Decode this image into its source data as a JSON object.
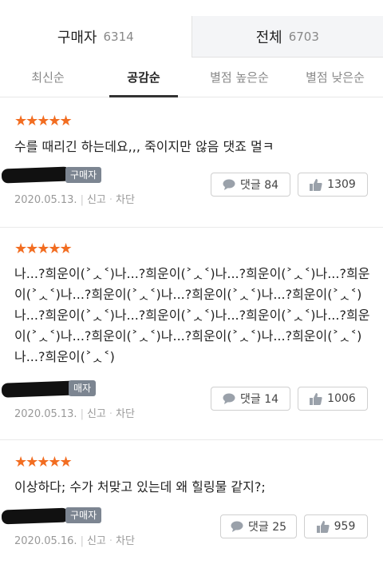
{
  "tabs": [
    {
      "label": "구매자",
      "count": "6314"
    },
    {
      "label": "전체",
      "count": "6703"
    }
  ],
  "sort_options": [
    "최신순",
    "공감순",
    "별점 높은순",
    "별점 낮은순"
  ],
  "colors": {
    "star": "#f26d21",
    "badge": "#7c8591"
  },
  "reviews": [
    {
      "stars": "★★★★★",
      "rating": 5,
      "text": "수를 때리긴 하는데요,,, 죽이지만 않음 댓죠 멀ㅋ",
      "badge": "구매자",
      "date": "2020.05.13.",
      "report": "신고",
      "block": "차단",
      "comment_label": "댓글 84",
      "like_count": "1309"
    },
    {
      "stars": "★★★★★",
      "rating": 5,
      "text": "나...?희운이(˃ᆺ˂)나...?희운이(˃ᆺ˂)나...?희운이(˃ᆺ˂)나...?희운이(˃ᆺ˂)나...?희운이(˃ᆺ˂)나...?희운이(˃ᆺ˂)나...?희운이(˃ᆺ˂)나...?희운이(˃ᆺ˂)나...?희운이(˃ᆺ˂)나...?희운이(˃ᆺ˂)나...?희운이(˃ᆺ˂)나...?희운이(˃ᆺ˂)나...?희운이(˃ᆺ˂)나...?희운이(˃ᆺ˂)나...?희운이(˃ᆺ˂)",
      "badge": "매자",
      "date": "2020.05.13.",
      "report": "신고",
      "block": "차단",
      "comment_label": "댓글 14",
      "like_count": "1006"
    },
    {
      "stars": "★★★★★",
      "rating": 5,
      "text": "이상하다; 수가 처맞고 있는데 왜 힐링물 같지?;",
      "badge": "구매자",
      "date": "2020.05.16.",
      "report": "신고",
      "block": "차단",
      "comment_label": "댓글 25",
      "like_count": "959"
    }
  ]
}
